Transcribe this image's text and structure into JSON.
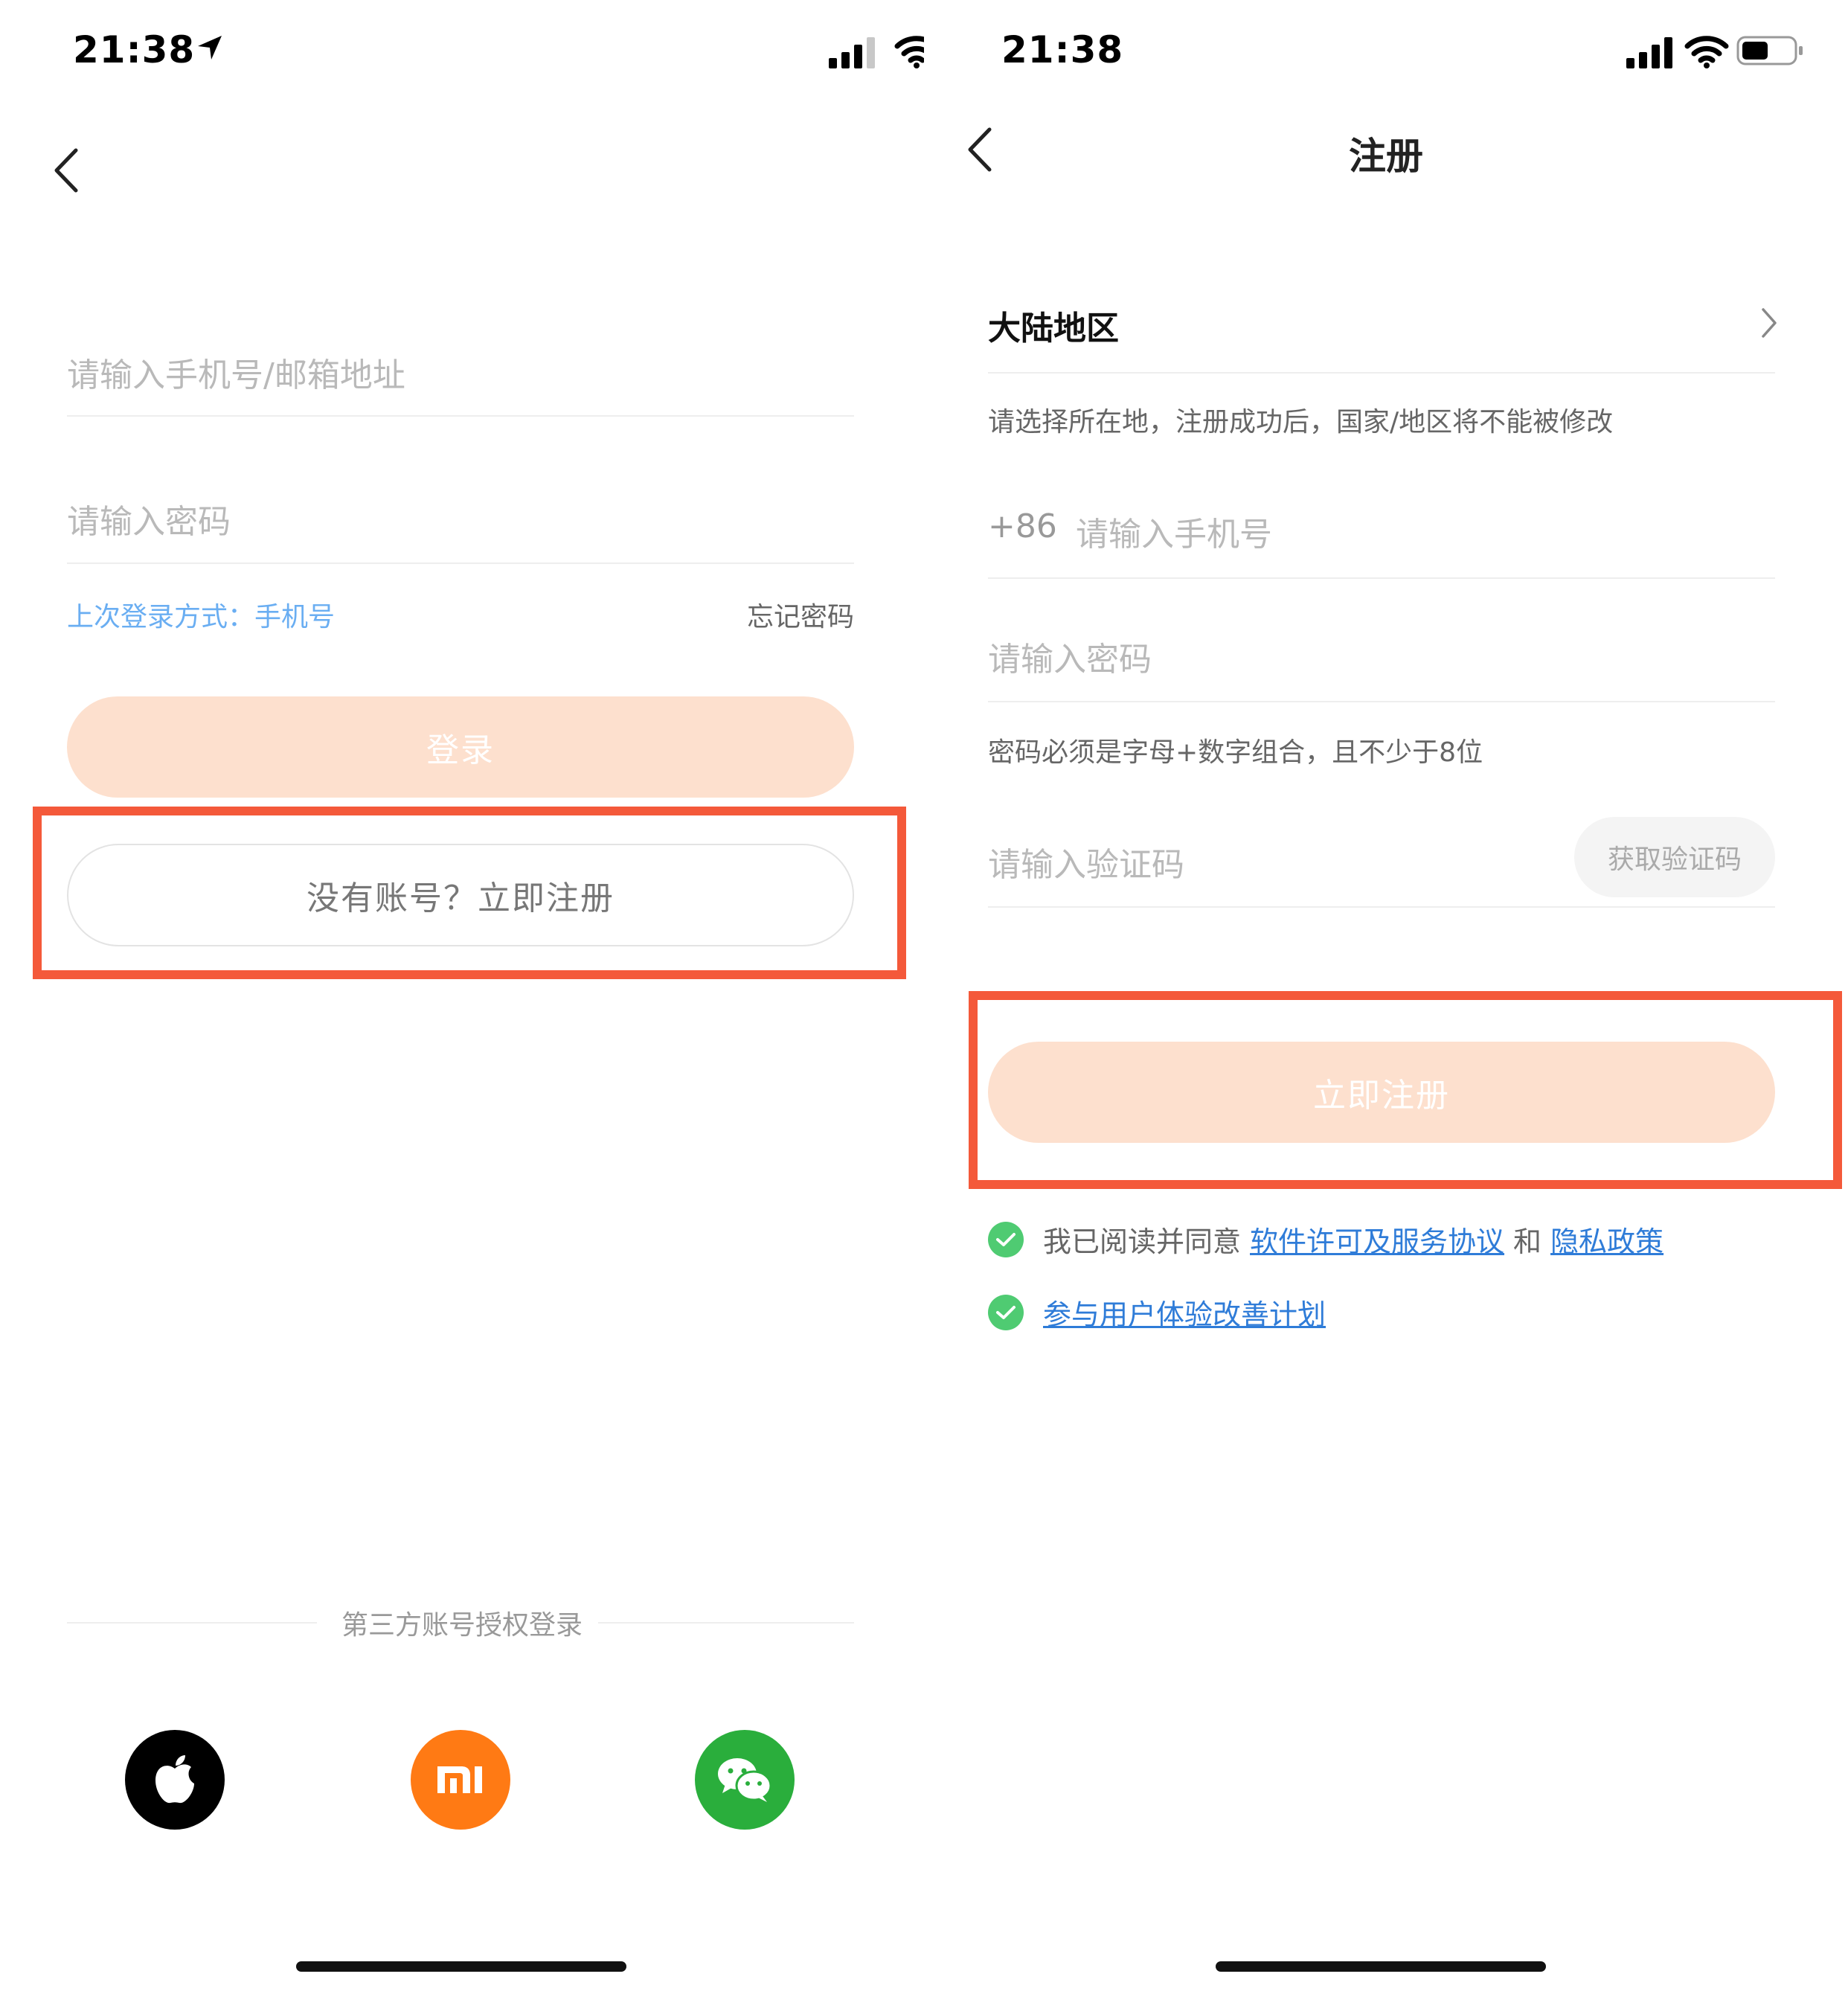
{
  "login": {
    "status_time": "21:38",
    "account_placeholder": "请输入手机号/邮箱地址",
    "password_placeholder": "请输入密码",
    "last_login_label": "上次登录方式：",
    "last_login_value": "手机号",
    "forgot_password": "忘记密码",
    "login_button": "登录",
    "register_prompt": "没有账号？立即注册",
    "third_party_label": "第三方账号授权登录",
    "social": [
      {
        "name": "apple",
        "icon": "apple-icon",
        "color": "#000000"
      },
      {
        "name": "mi",
        "icon": "mi-icon",
        "color": "#ff7a14",
        "text": "mi"
      },
      {
        "name": "wechat",
        "icon": "wechat-icon",
        "color": "#2aae3c"
      }
    ]
  },
  "register": {
    "status_time": "21:38",
    "title": "注册",
    "region_label": "大陆地区",
    "region_hint": "请选择所在地，注册成功后，国家/地区将不能被修改",
    "country_code": "+86",
    "phone_placeholder": "请输入手机号",
    "password_placeholder": "请输入密码",
    "password_hint": "密码必须是字母+数字组合，且不少于8位",
    "code_placeholder": "请输入验证码",
    "get_code_button": "获取验证码",
    "register_button": "立即注册",
    "agree_prefix": "我已阅读并同意",
    "license_link": "软件许可及服务协议",
    "and_text": "和",
    "privacy_link": "隐私政策",
    "ux_plan_link": "参与用户体验改善计划"
  },
  "colors": {
    "accent_pill": "#fde0ce",
    "highlight": "#f4593a",
    "link_blue": "#2f7cd8",
    "check_green": "#4fcb72"
  }
}
